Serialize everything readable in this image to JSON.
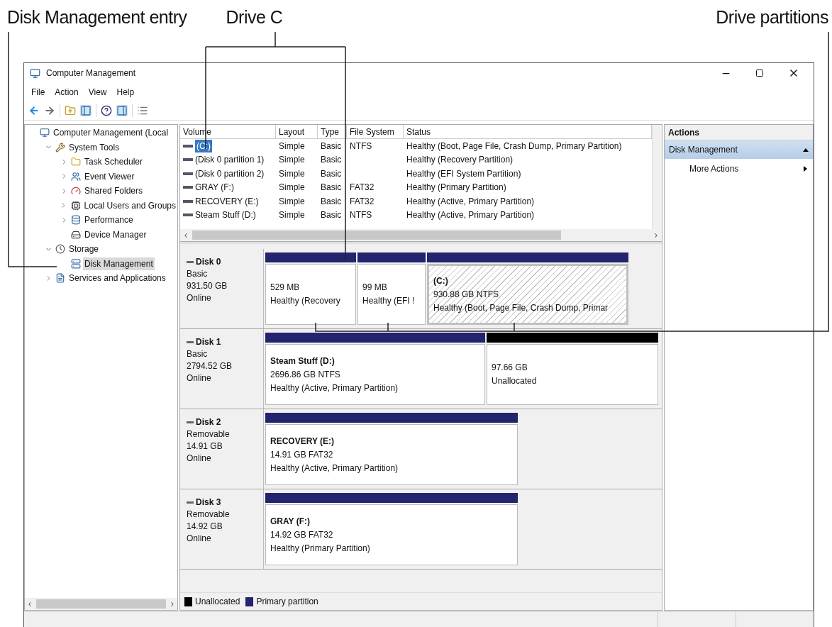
{
  "annotations": [
    "Disk Management entry",
    "Drive C",
    "Drive partitions"
  ],
  "window": {
    "title": "Computer Management"
  },
  "menu": [
    "File",
    "Action",
    "View",
    "Help"
  ],
  "tree": [
    {
      "label": "Computer Management (Local",
      "selected": false,
      "children": [
        {
          "label": "System Tools",
          "expanded": true,
          "selected": false,
          "children": [
            {
              "label": "Task Scheduler",
              "expanded": false,
              "selected": false
            },
            {
              "label": "Event Viewer",
              "expanded": false,
              "selected": false
            },
            {
              "label": "Shared Folders",
              "expanded": false,
              "selected": false
            },
            {
              "label": "Local Users and Groups",
              "expanded": false,
              "selected": false
            },
            {
              "label": "Performance",
              "expanded": false,
              "selected": false
            },
            {
              "label": "Device Manager",
              "selected": false
            }
          ]
        },
        {
          "label": "Storage",
          "expanded": true,
          "selected": false,
          "children": [
            {
              "label": "Disk Management",
              "selected": true
            }
          ]
        },
        {
          "label": "Services and Applications",
          "expanded": false,
          "selected": false
        }
      ]
    }
  ],
  "volumes": {
    "columns": [
      "Volume",
      "Layout",
      "Type",
      "File System",
      "Status"
    ],
    "rows": [
      {
        "selected": true,
        "cells": [
          "(C:)",
          "Simple",
          "Basic",
          "NTFS",
          "Healthy (Boot, Page File, Crash Dump, Primary Partition)"
        ]
      },
      {
        "selected": false,
        "cells": [
          "(Disk 0 partition 1)",
          "Simple",
          "Basic",
          "",
          "Healthy (Recovery Partition)"
        ]
      },
      {
        "selected": false,
        "cells": [
          "(Disk 0 partition 2)",
          "Simple",
          "Basic",
          "",
          "Healthy (EFI System Partition)"
        ]
      },
      {
        "selected": false,
        "cells": [
          "GRAY (F:)",
          "Simple",
          "Basic",
          "FAT32",
          "Healthy (Primary Partition)"
        ]
      },
      {
        "selected": false,
        "cells": [
          "RECOVERY (E:)",
          "Simple",
          "Basic",
          "FAT32",
          "Healthy (Active, Primary Partition)"
        ]
      },
      {
        "selected": false,
        "cells": [
          "Steam Stuff (D:)",
          "Simple",
          "Basic",
          "NTFS",
          "Healthy (Active, Primary Partition)"
        ]
      }
    ]
  },
  "disks": [
    {
      "name": "Disk 0",
      "type": "Basic",
      "size": "931.50 GB",
      "status": "Online",
      "partitions": [
        {
          "kind": "primary",
          "selected": false,
          "lines": [
            "529 MB",
            "Healthy (Recovery"
          ]
        },
        {
          "kind": "primary",
          "selected": false,
          "lines": [
            "99 MB",
            "Healthy (EFI !"
          ]
        },
        {
          "kind": "primary",
          "selected": true,
          "name": "(C:)",
          "lines": [
            "930.88 GB NTFS",
            "Healthy (Boot, Page File, Crash Dump, Primar"
          ]
        }
      ]
    },
    {
      "name": "Disk 1",
      "type": "Basic",
      "size": "2794.52 GB",
      "status": "Online",
      "partitions": [
        {
          "kind": "primary",
          "selected": false,
          "name": "Steam Stuff  (D:)",
          "lines": [
            "2696.86 GB NTFS",
            "Healthy (Active, Primary Partition)"
          ]
        },
        {
          "kind": "unallocated",
          "selected": false,
          "lines": [
            "97.66 GB",
            "Unallocated"
          ]
        }
      ]
    },
    {
      "name": "Disk 2",
      "type": "Removable",
      "size": "14.91 GB",
      "status": "Online",
      "partitions": [
        {
          "kind": "primary",
          "selected": false,
          "name": "RECOVERY  (E:)",
          "lines": [
            "14.91 GB FAT32",
            "Healthy (Active, Primary Partition)"
          ]
        }
      ]
    },
    {
      "name": "Disk 3",
      "type": "Removable",
      "size": "14.92 GB",
      "status": "Online",
      "partitions": [
        {
          "kind": "primary",
          "selected": false,
          "name": "GRAY  (F:)",
          "lines": [
            "14.92 GB FAT32",
            "Healthy (Primary Partition)"
          ]
        }
      ]
    }
  ],
  "legend": [
    {
      "kind": "unallocated",
      "label": "Unallocated"
    },
    {
      "kind": "primary",
      "label": "Primary partition"
    }
  ],
  "actions": {
    "title": "Actions",
    "sections": [
      {
        "label": "Disk Management",
        "expanded": true,
        "items": [
          "More Actions"
        ]
      }
    ]
  }
}
